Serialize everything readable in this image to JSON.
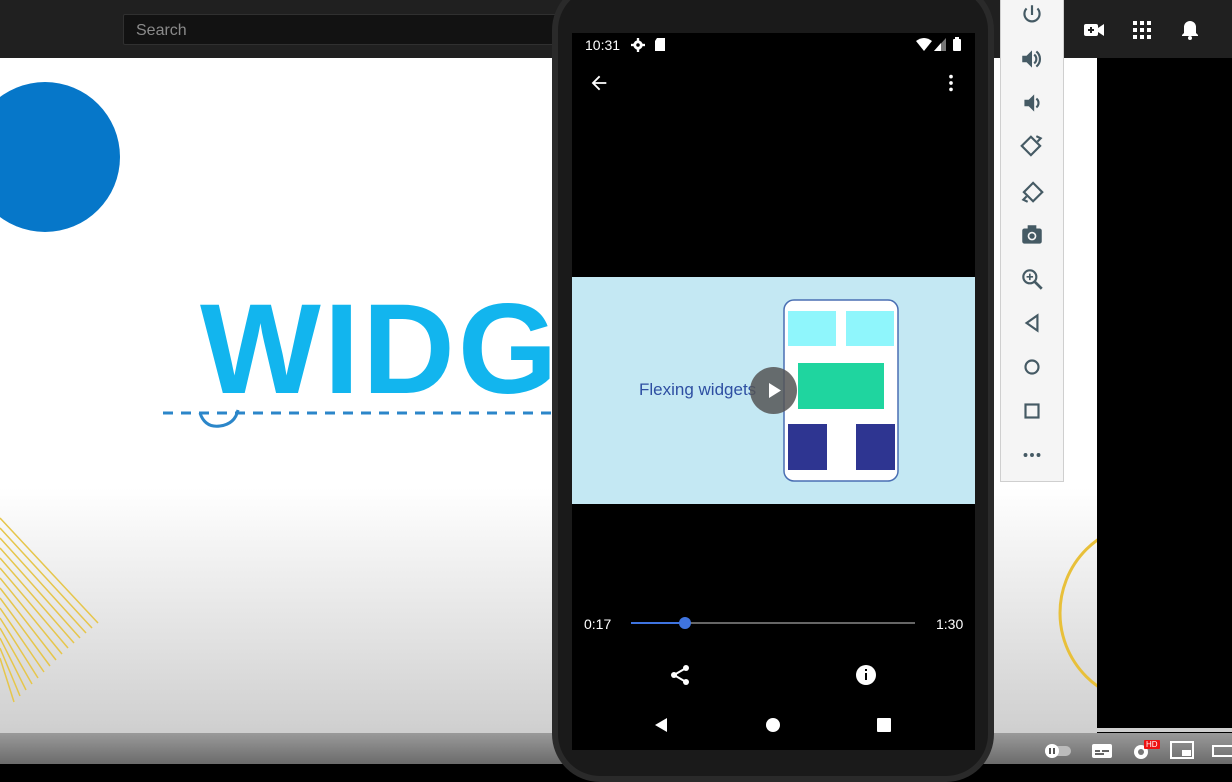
{
  "youtube": {
    "search_placeholder": "Search",
    "icons": [
      "video-camera-add-icon",
      "apps-grid-icon",
      "bell-icon"
    ],
    "video_title_text": "WIDG",
    "bottom_icons": [
      "autoplay-toggle-icon",
      "subtitles-icon",
      "settings-hd-icon",
      "miniplayer-icon",
      "theater-icon"
    ],
    "hd_badge": "HD"
  },
  "phone": {
    "status": {
      "time": "10:31",
      "icons": [
        "gear-icon",
        "sd-card-icon",
        "wifi-icon",
        "signal-icon",
        "battery-icon"
      ]
    },
    "video": {
      "caption": "Flexing widgets",
      "current_time": "0:17",
      "duration": "1:30",
      "progress_fraction": 0.19
    },
    "actions": [
      "share-icon",
      "info-icon"
    ],
    "nav": [
      "back-icon",
      "home-icon",
      "recents-icon"
    ]
  },
  "emulator_toolbar": {
    "buttons": [
      "power-icon",
      "volume-up-icon",
      "volume-down-icon",
      "rotate-left-icon",
      "rotate-right-icon",
      "screenshot-icon",
      "zoom-icon",
      "back-icon",
      "home-icon",
      "overview-icon",
      "more-icon"
    ]
  },
  "colors": {
    "accent_blue": "#3f74e0",
    "title_cyan": "#12b5ee",
    "widget_green": "#1fd59f",
    "widget_navy": "#2e3591",
    "widget_cyan": "#8ff6fc"
  }
}
